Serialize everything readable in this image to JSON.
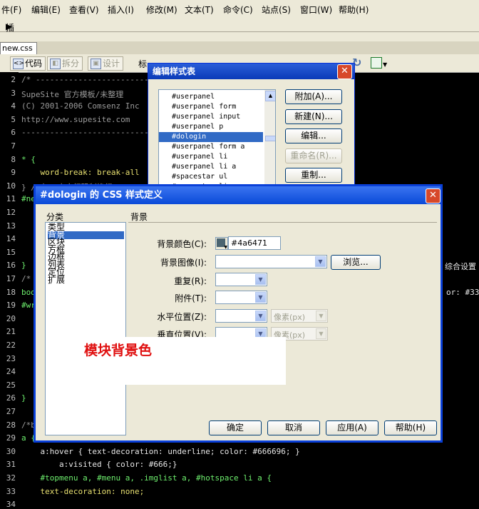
{
  "menu": [
    "件(F)",
    "编辑(E)",
    "查看(V)",
    "插入(I)",
    "修改(M)",
    "文本(T)",
    "命令(C)",
    "站点(S)",
    "窗口(W)",
    "帮助(H)"
  ],
  "insert_bar": {
    "arrow": "▶",
    "label": "插入"
  },
  "doc_tab": "new.css",
  "toolbar": {
    "code": "代码",
    "split": "拆分",
    "design": "设计",
    "title_label": "标"
  },
  "code": {
    "line_numbers": [
      "2",
      "3",
      "4",
      "5",
      "6",
      "7",
      "8",
      "9",
      "10",
      "11",
      "12",
      "13",
      "14",
      "15",
      "16",
      "17",
      "18",
      "19",
      "20",
      "21",
      "22",
      "23",
      "24",
      "25",
      "26",
      "27",
      "28",
      "29",
      "30",
      "31",
      "32",
      "33",
      "34"
    ],
    "lines": [
      {
        "n": 0,
        "text": "/* -------------------------------",
        "cls": "cmt"
      },
      {
        "n": 1,
        "text": "SupeSite 官方模板/未整理",
        "cls": "cmt"
      },
      {
        "n": 2,
        "text": "(C) 2001-2006 Comsenz Inc",
        "cls": "cmt"
      },
      {
        "n": 3,
        "text": "http://www.supesite.com",
        "cls": "cmt"
      },
      {
        "n": 4,
        "text": "-----------------------------------",
        "cls": "cmt"
      },
      {
        "n": 6,
        "text": "* {",
        "cls": "sel"
      },
      {
        "n": 7,
        "text": "    word-break: break-all",
        "cls": "prop"
      },
      {
        "n": 8,
        "text": "} /*在IE中实行强制换行*/",
        "cls": "cmt"
      },
      {
        "n": 9,
        "text": "#ne",
        "cls": "sel"
      },
      {
        "n": 14,
        "text": "}",
        "cls": "sel"
      },
      {
        "n": 15,
        "text": "/*",
        "cls": "cmt"
      },
      {
        "n": 16,
        "text": "bod",
        "cls": "sel"
      },
      {
        "n": 17,
        "text": "#wr",
        "cls": "sel"
      },
      {
        "n": 24,
        "text": "}",
        "cls": "sel"
      },
      {
        "n": 26,
        "text": "/*b",
        "cls": "cmt"
      },
      {
        "n": 27,
        "text": "a {",
        "cls": "sel"
      },
      {
        "n": 28,
        "text": "    a:hover { text-decoration: underline; color: #666696; }",
        "cls": "val"
      },
      {
        "n": 29,
        "text": "        a:visited { color: #666;}",
        "cls": "val"
      },
      {
        "n": 30,
        "text": "    #topmenu a, #menu a, .imglist a, #hotspace li a {",
        "cls": "sel"
      },
      {
        "n": 31,
        "text": "    text-decoration: none;",
        "cls": "prop"
      }
    ],
    "right_text_1": "综合设置",
    "right_text_2": "or: #33"
  },
  "dialog_styles": {
    "title": "编辑样式表",
    "items": [
      "#userpanel",
      "#userpanel form",
      "#userpanel input",
      "#userpanel p",
      "#dologin",
      "#userpanel form a",
      "#userpanel li",
      "#userpanel li a",
      "#spacestar ul",
      "#spacestar li"
    ],
    "selected_index": 4,
    "buttons": [
      {
        "label": "附加(A)...",
        "disabled": false
      },
      {
        "label": "新建(N)...",
        "disabled": false
      },
      {
        "label": "编辑...",
        "disabled": false
      },
      {
        "label": "重命名(R)...",
        "disabled": true
      },
      {
        "label": "重制...",
        "disabled": false
      }
    ]
  },
  "dialog_css": {
    "title": "#dologin 的 CSS 样式定义",
    "category_header": "分类",
    "section_header": "背景",
    "categories": [
      "类型",
      "背景",
      "区块",
      "方框",
      "边框",
      "列表",
      "定位",
      "扩展"
    ],
    "selected_category": 1,
    "fields": {
      "bg_color_label": "背景颜色(C):",
      "bg_color_value": "#4a6471",
      "bg_color_swatch": "#4a6471",
      "bg_image_label": "背景图像(I):",
      "bg_image_value": "",
      "browse_button": "浏览...",
      "repeat_label": "重复(R):",
      "attachment_label": "附件(T):",
      "hpos_label": "水平位置(Z):",
      "vpos_label": "垂直位置(V):",
      "unit_placeholder": "像素(px)"
    },
    "annotation": "模块背景色",
    "buttons": {
      "ok": "确定",
      "cancel": "取消",
      "apply": "应用(A)",
      "help": "帮助(H)"
    }
  }
}
